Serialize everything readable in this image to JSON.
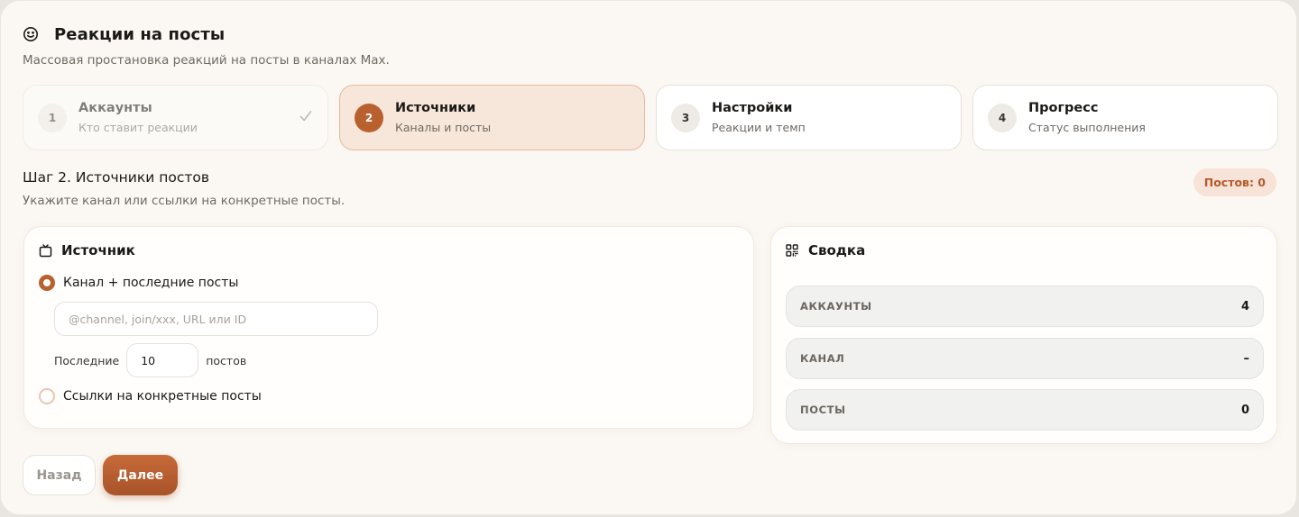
{
  "header": {
    "title": "Реакции на посты",
    "subtitle": "Массовая простановка реакций на посты в каналах Max.",
    "icon": "smile-icon"
  },
  "steps": [
    {
      "num": "1",
      "title": "Аккаунты",
      "desc": "Кто ставит реакции",
      "state": "done"
    },
    {
      "num": "2",
      "title": "Источники",
      "desc": "Каналы и посты",
      "state": "active"
    },
    {
      "num": "3",
      "title": "Настройки",
      "desc": "Реакции и темп",
      "state": "pending"
    },
    {
      "num": "4",
      "title": "Прогресс",
      "desc": "Статус выполнения",
      "state": "pending"
    }
  ],
  "section": {
    "title": "Шаг 2. Источники постов",
    "desc": "Укажите канал или ссылки на конкретные посты.",
    "posts_badge": "Постов: 0"
  },
  "source": {
    "title": "Источник",
    "option_channel": "Канал + последние посты",
    "channel_placeholder": "@channel, join/xxx, URL или ID",
    "channel_value": "",
    "last_label": "Последние",
    "last_count": "10",
    "posts_label": "постов",
    "option_links": "Ссылки на конкретные посты",
    "selected": "channel"
  },
  "summary": {
    "title": "Сводка",
    "rows": [
      {
        "label": "АККАУНТЫ",
        "value": "4"
      },
      {
        "label": "КАНАЛ",
        "value": "–"
      },
      {
        "label": "ПОСТЫ",
        "value": "0"
      }
    ]
  },
  "buttons": {
    "back": "Назад",
    "next": "Далее"
  },
  "colors": {
    "accent": "#b9602f",
    "background": "#fbf8f3",
    "badge_bg": "#f7e3d7"
  }
}
